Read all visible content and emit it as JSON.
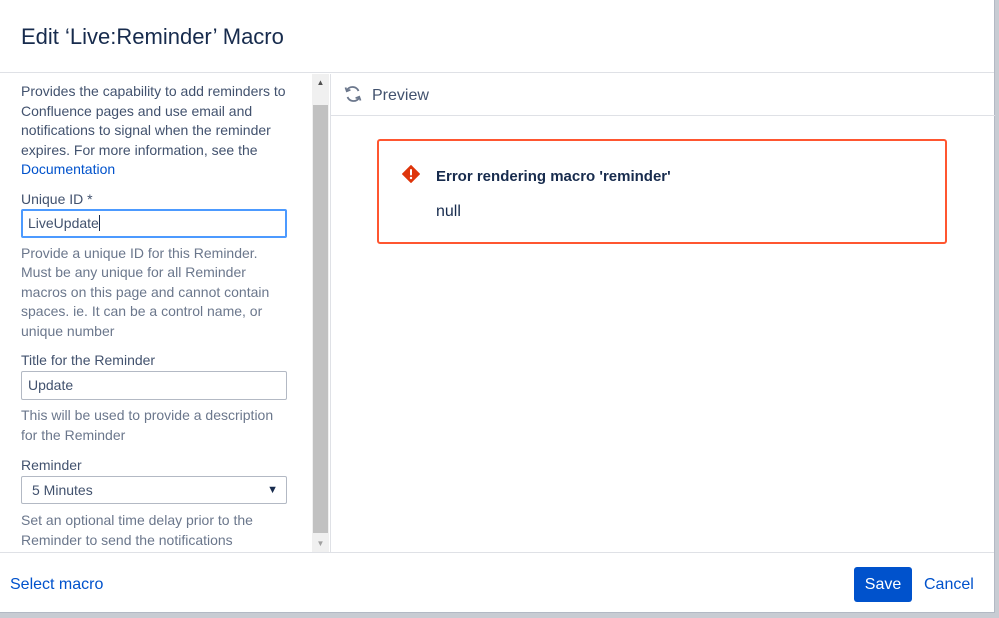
{
  "dialog": {
    "title": "Edit ‘Live:Reminder’ Macro"
  },
  "left": {
    "description": "Provides the capability to add reminders to Confluence pages and use email and notifications to signal when the reminder expires. For more information, see the",
    "doc_link": "Documentation",
    "fields": {
      "unique_id": {
        "label": "Unique ID *",
        "value": "LiveUpdate",
        "help": "Provide a unique ID for this Reminder. Must be any unique for all Reminder macros on this page and cannot contain spaces. ie. It can be a control name, or unique number"
      },
      "title": {
        "label": "Title for the Reminder",
        "value": "Update",
        "help": "This will be used to provide a description for the Reminder"
      },
      "reminder": {
        "label": "Reminder",
        "selected": "5 Minutes",
        "arrow": "▼",
        "help": "Set an optional time delay prior to the Reminder to send the notifications"
      }
    }
  },
  "scrollbar": {
    "up": "▲",
    "down": "▼"
  },
  "preview": {
    "title": "Preview",
    "icon": "refresh-icon",
    "error": {
      "icon": "error-icon",
      "title": "Error rendering macro 'reminder'",
      "message": "null"
    }
  },
  "footer": {
    "select_macro": "Select macro",
    "save": "Save",
    "cancel": "Cancel"
  },
  "colors": {
    "primary": "#0052cc",
    "error_border": "#ff5630",
    "focus_border": "#4c9aff"
  }
}
